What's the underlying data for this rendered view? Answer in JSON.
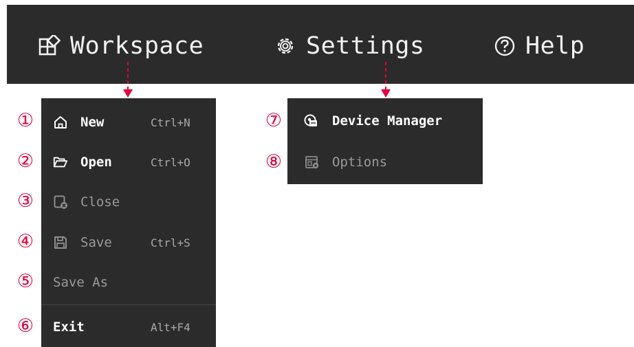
{
  "menubar": {
    "items": [
      {
        "label": "Workspace",
        "icon": "workspace-icon"
      },
      {
        "label": "Settings",
        "icon": "gear-icon"
      },
      {
        "label": "Help",
        "icon": "help-icon"
      }
    ]
  },
  "workspace_menu": {
    "items": [
      {
        "label": "New",
        "shortcut": "Ctrl+N",
        "icon": "home-icon",
        "enabled": true
      },
      {
        "label": "Open",
        "shortcut": "Ctrl+O",
        "icon": "folder-open-icon",
        "enabled": true
      },
      {
        "label": "Close",
        "shortcut": "",
        "icon": "close-file-icon",
        "enabled": false
      },
      {
        "label": "Save",
        "shortcut": "Ctrl+S",
        "icon": "save-icon",
        "enabled": false
      },
      {
        "label": "Save As",
        "shortcut": "",
        "icon": "",
        "enabled": false
      },
      {
        "label": "Exit",
        "shortcut": "Alt+F4",
        "icon": "",
        "enabled": true
      }
    ]
  },
  "settings_menu": {
    "items": [
      {
        "label": "Device Manager",
        "icon": "device-manager-icon",
        "enabled": true
      },
      {
        "label": "Options",
        "icon": "options-icon",
        "enabled": false
      }
    ]
  },
  "markers": [
    "①",
    "②",
    "③",
    "④",
    "⑤",
    "⑥",
    "⑦",
    "⑧"
  ],
  "colors": {
    "menu_background": "#2b2b2b",
    "marker": "#e4003a",
    "enabled_text": "#ffffff",
    "disabled_text": "#9a9a9a"
  }
}
